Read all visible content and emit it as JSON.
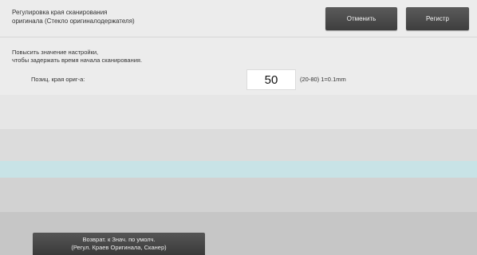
{
  "header": {
    "title": "Регулировка края сканирования\nоригинала (Стекло оригиналодержателя)",
    "cancel_label": "Отменить",
    "register_label": "Регистр"
  },
  "content": {
    "hint": "Повысить значение настройки,\nчтобы задержать время начала сканирования.",
    "param_label": "Позиц. края ориг-а:",
    "param_value": "50",
    "param_range": "(20-80) 1=0.1mm"
  },
  "footer": {
    "reset_label": "Возврат. к Знач. по умолч.\n(Регул. Краев Оригинала, Сканер)"
  }
}
